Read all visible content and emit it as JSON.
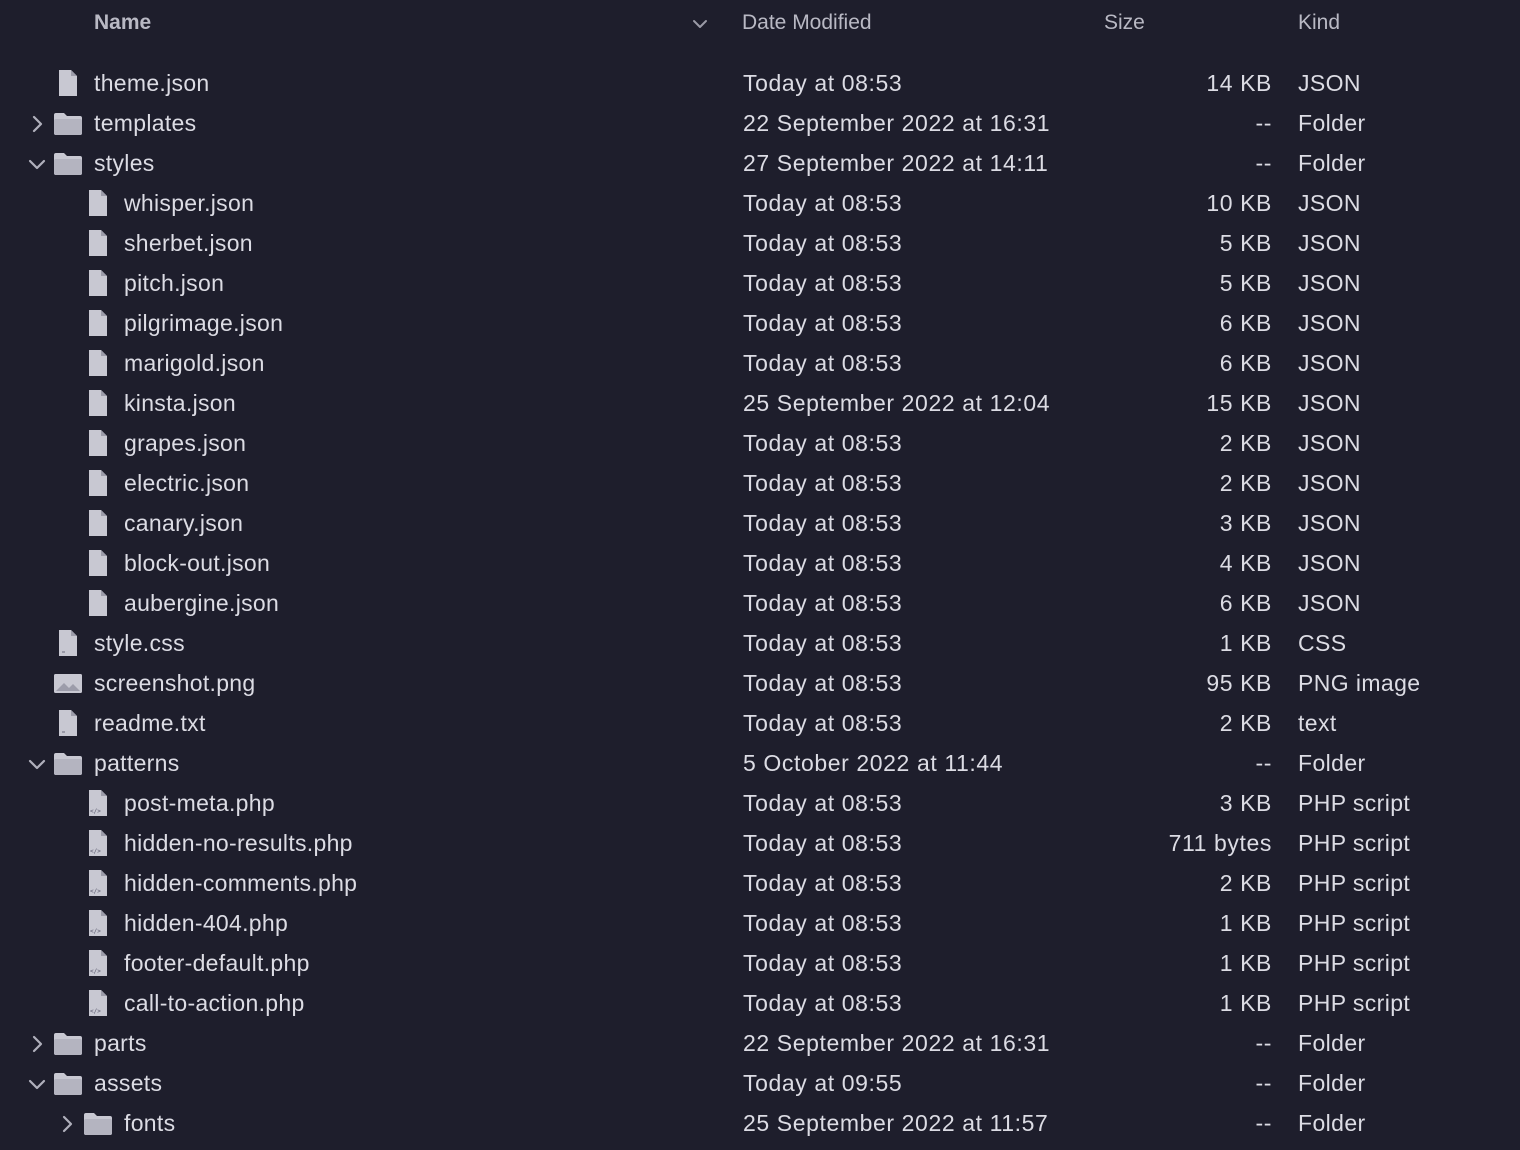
{
  "columns": {
    "name": "Name",
    "date_modified": "Date Modified",
    "size": "Size",
    "kind": "Kind"
  },
  "colors": {
    "background": "#1e1e2c",
    "text": "#dcdce4",
    "header_text": "#b9b9c4",
    "icon": "#c8c8d2"
  },
  "rows": [
    {
      "name": "theme.json",
      "date": "Today at 08:53",
      "size": "14 KB",
      "kind": "JSON",
      "level": 0,
      "type": "file",
      "icon": "document-icon"
    },
    {
      "name": "templates",
      "date": "22 September 2022 at 16:31",
      "size": "--",
      "kind": "Folder",
      "level": 0,
      "type": "folder",
      "expanded": false,
      "icon": "folder-icon"
    },
    {
      "name": "styles",
      "date": "27 September 2022 at 14:11",
      "size": "--",
      "kind": "Folder",
      "level": 0,
      "type": "folder",
      "expanded": true,
      "icon": "folder-icon"
    },
    {
      "name": "whisper.json",
      "date": "Today at 08:53",
      "size": "10 KB",
      "kind": "JSON",
      "level": 1,
      "type": "file",
      "icon": "document-icon"
    },
    {
      "name": "sherbet.json",
      "date": "Today at 08:53",
      "size": "5 KB",
      "kind": "JSON",
      "level": 1,
      "type": "file",
      "icon": "document-icon"
    },
    {
      "name": "pitch.json",
      "date": "Today at 08:53",
      "size": "5 KB",
      "kind": "JSON",
      "level": 1,
      "type": "file",
      "icon": "document-icon"
    },
    {
      "name": "pilgrimage.json",
      "date": "Today at 08:53",
      "size": "6 KB",
      "kind": "JSON",
      "level": 1,
      "type": "file",
      "icon": "document-icon"
    },
    {
      "name": "marigold.json",
      "date": "Today at 08:53",
      "size": "6 KB",
      "kind": "JSON",
      "level": 1,
      "type": "file",
      "icon": "document-icon"
    },
    {
      "name": "kinsta.json",
      "date": "25 September 2022 at 12:04",
      "size": "15 KB",
      "kind": "JSON",
      "level": 1,
      "type": "file",
      "icon": "document-icon"
    },
    {
      "name": "grapes.json",
      "date": "Today at 08:53",
      "size": "2 KB",
      "kind": "JSON",
      "level": 1,
      "type": "file",
      "icon": "document-icon"
    },
    {
      "name": "electric.json",
      "date": "Today at 08:53",
      "size": "2 KB",
      "kind": "JSON",
      "level": 1,
      "type": "file",
      "icon": "document-icon"
    },
    {
      "name": "canary.json",
      "date": "Today at 08:53",
      "size": "3 KB",
      "kind": "JSON",
      "level": 1,
      "type": "file",
      "icon": "document-icon"
    },
    {
      "name": "block-out.json",
      "date": "Today at 08:53",
      "size": "4 KB",
      "kind": "JSON",
      "level": 1,
      "type": "file",
      "icon": "document-icon"
    },
    {
      "name": "aubergine.json",
      "date": "Today at 08:53",
      "size": "6 KB",
      "kind": "JSON",
      "level": 1,
      "type": "file",
      "icon": "document-icon"
    },
    {
      "name": "style.css",
      "date": "Today at 08:53",
      "size": "1 KB",
      "kind": "CSS",
      "level": 0,
      "type": "file",
      "icon": "css-file-icon"
    },
    {
      "name": "screenshot.png",
      "date": "Today at 08:53",
      "size": "95 KB",
      "kind": "PNG image",
      "level": 0,
      "type": "image",
      "icon": "image-file-icon"
    },
    {
      "name": "readme.txt",
      "date": "Today at 08:53",
      "size": "2 KB",
      "kind": "text",
      "level": 0,
      "type": "file",
      "icon": "text-file-icon"
    },
    {
      "name": "patterns",
      "date": "5 October 2022 at 11:44",
      "size": "--",
      "kind": "Folder",
      "level": 0,
      "type": "folder",
      "expanded": true,
      "icon": "folder-icon"
    },
    {
      "name": "post-meta.php",
      "date": "Today at 08:53",
      "size": "3 KB",
      "kind": "PHP script",
      "level": 1,
      "type": "php",
      "icon": "php-file-icon"
    },
    {
      "name": "hidden-no-results.php",
      "date": "Today at 08:53",
      "size": "711 bytes",
      "kind": "PHP script",
      "level": 1,
      "type": "php",
      "icon": "php-file-icon"
    },
    {
      "name": "hidden-comments.php",
      "date": "Today at 08:53",
      "size": "2 KB",
      "kind": "PHP script",
      "level": 1,
      "type": "php",
      "icon": "php-file-icon"
    },
    {
      "name": "hidden-404.php",
      "date": "Today at 08:53",
      "size": "1 KB",
      "kind": "PHP script",
      "level": 1,
      "type": "php",
      "icon": "php-file-icon"
    },
    {
      "name": "footer-default.php",
      "date": "Today at 08:53",
      "size": "1 KB",
      "kind": "PHP script",
      "level": 1,
      "type": "php",
      "icon": "php-file-icon"
    },
    {
      "name": "call-to-action.php",
      "date": "Today at 08:53",
      "size": "1 KB",
      "kind": "PHP script",
      "level": 1,
      "type": "php",
      "icon": "php-file-icon"
    },
    {
      "name": "parts",
      "date": "22 September 2022 at 16:31",
      "size": "--",
      "kind": "Folder",
      "level": 0,
      "type": "folder",
      "expanded": false,
      "icon": "folder-icon"
    },
    {
      "name": "assets",
      "date": "Today at 09:55",
      "size": "--",
      "kind": "Folder",
      "level": 0,
      "type": "folder",
      "expanded": true,
      "icon": "folder-icon"
    },
    {
      "name": "fonts",
      "date": "25 September 2022 at 11:57",
      "size": "--",
      "kind": "Folder",
      "level": 1,
      "type": "folder",
      "expanded": false,
      "icon": "folder-icon"
    }
  ]
}
